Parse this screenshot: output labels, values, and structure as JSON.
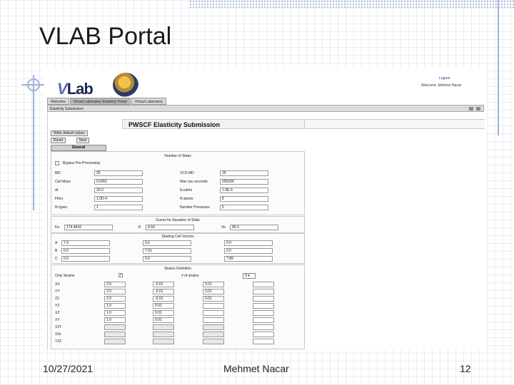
{
  "slide": {
    "title": "VLAB Portal",
    "footer_date": "10/27/2021",
    "footer_author": "Mehmet Nacar",
    "footer_page": "12"
  },
  "portal": {
    "logo_v": "V",
    "logo_lab": "Lab",
    "logout": "Logout",
    "welcome": "Welcome, Mehmet Nacar",
    "tabs": [
      "Welcome",
      "Virtual Laboratory Elasticity Portal",
      "Virtual Laboratory"
    ],
    "portlet_title": "Elasticity Submission"
  },
  "form": {
    "header": "PWSCF Elasticity Submission",
    "write_defaults": "Write default values",
    "reset": "Reset",
    "next": "Next",
    "section_tab": "General",
    "steps_title": "Number of Steps",
    "bypass_label": "Bypass Pre-Processing",
    "left_fields": [
      {
        "label": "MD",
        "value": "25"
      },
      {
        "label": "Cell Mass",
        "value": "0.0051"
      },
      {
        "label": "dt",
        "value": "20.0"
      },
      {
        "label": "Fthrs",
        "value": "1.0D-4"
      },
      {
        "label": "N types",
        "value": "1"
      }
    ],
    "right_fields": [
      {
        "label": "VCS-MD",
        "value": "25"
      },
      {
        "label": "Max cpu seconds",
        "value": "259200"
      },
      {
        "label": "Ecutrho",
        "value": "1.0E-5"
      },
      {
        "label": "N atoms",
        "value": "8"
      },
      {
        "label": "Number Pressures",
        "value": "5"
      }
    ],
    "eos_title": "Guess for Equation of State",
    "eos": [
      {
        "label": "Ko",
        "value": "174.4643"
      },
      {
        "label": "K'",
        "value": "4.58"
      },
      {
        "label": "Vo",
        "value": "85.0"
      }
    ],
    "cell_title": "Starting Cell Vectors",
    "cell_rows": [
      {
        "label": "A",
        "values": [
          "7.9",
          "0.0",
          "0.0"
        ]
      },
      {
        "label": "B",
        "values": [
          "0.0",
          "7.91",
          "0.0"
        ]
      },
      {
        "label": "C",
        "values": [
          "0.0",
          "0.0",
          "7.89"
        ]
      }
    ],
    "strain_title": "Strains Definition",
    "only_strains": "Only Strains",
    "num_strains": "# of strains",
    "num_strains_value": "3",
    "strain_rows": [
      {
        "label": "XX",
        "values": [
          "2.0",
          "-0.01",
          "0.01"
        ]
      },
      {
        "label": "YY",
        "values": [
          "2.0",
          "-0.01",
          "0.01"
        ]
      },
      {
        "label": "ZZ",
        "values": [
          "2.0",
          "-0.01",
          "0.01"
        ]
      },
      {
        "label": "YZ",
        "values": [
          "1.0",
          "0.01",
          ""
        ]
      },
      {
        "label": "XZ",
        "values": [
          "1.0",
          "0.01",
          ""
        ]
      },
      {
        "label": "XY",
        "values": [
          "1.0",
          "0.01",
          ""
        ]
      },
      {
        "label": "X2Y",
        "values": [
          "",
          "",
          ""
        ]
      },
      {
        "label": "X2z",
        "values": [
          "",
          "",
          ""
        ]
      },
      {
        "label": "Y2Z",
        "values": [
          "",
          "",
          ""
        ]
      }
    ]
  }
}
